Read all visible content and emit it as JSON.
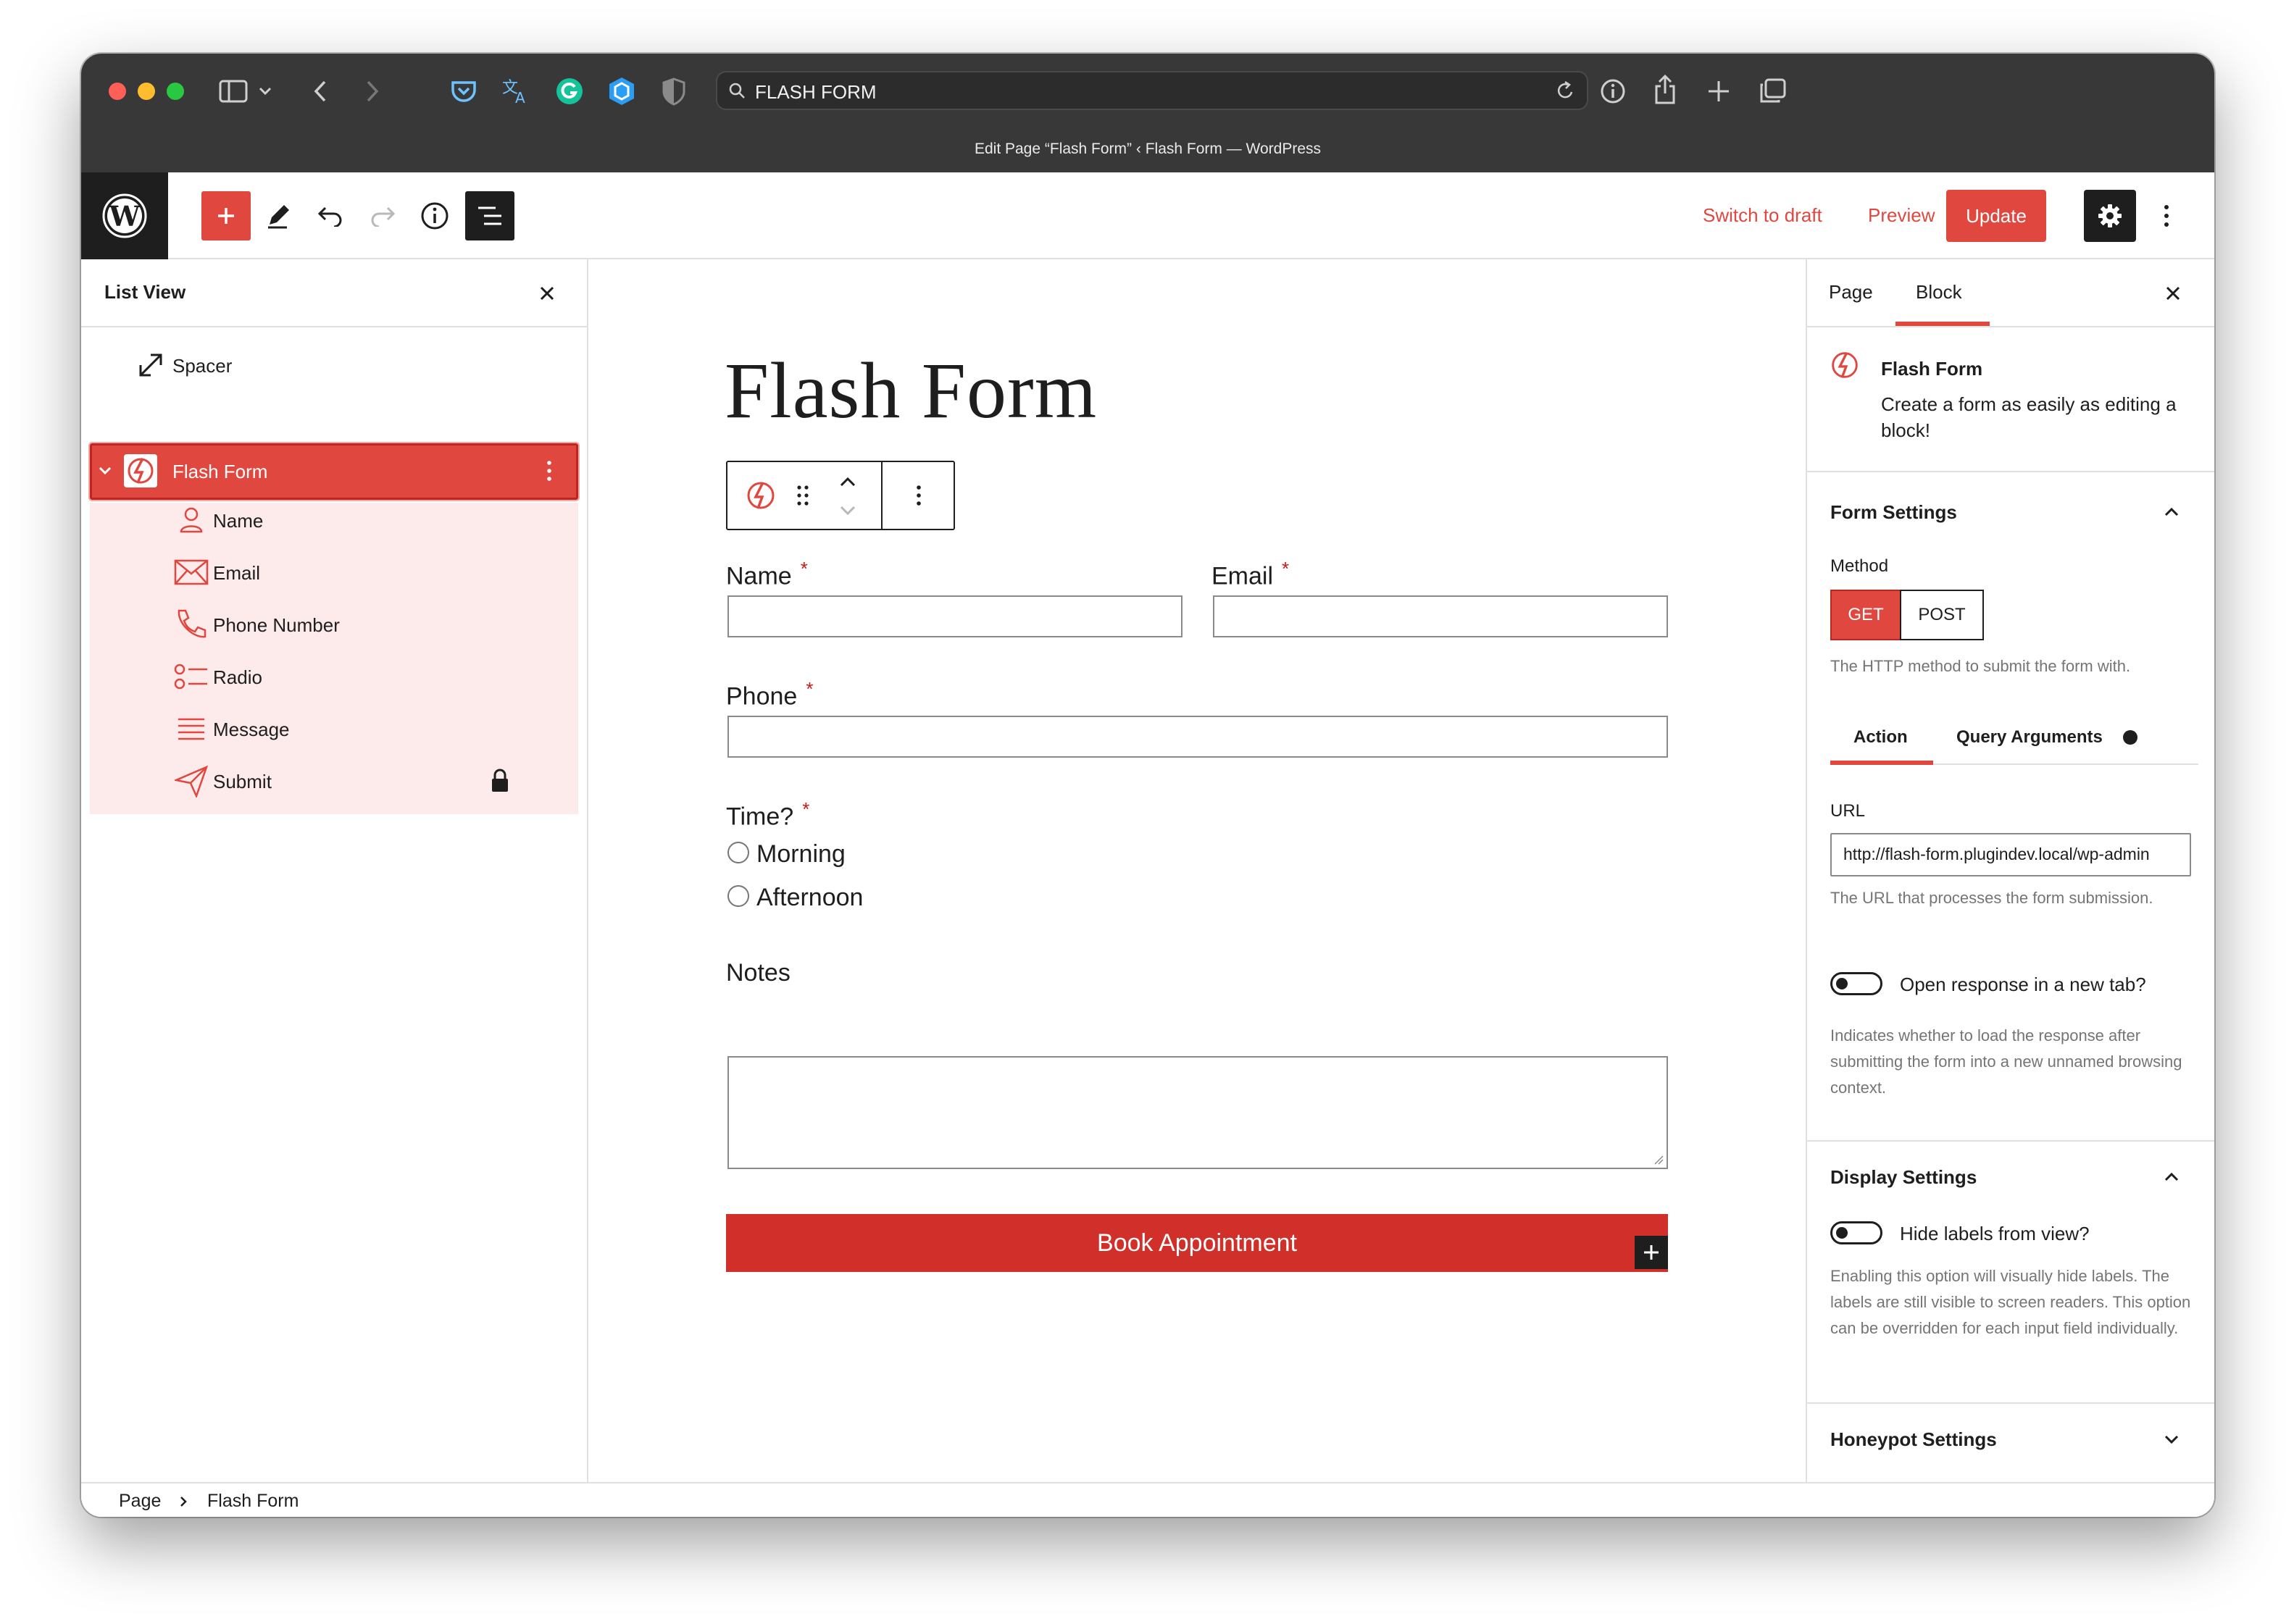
{
  "browser": {
    "url": "FLASH FORM",
    "window_title": "Edit Page “Flash Form” ‹ Flash Form — WordPress"
  },
  "toolbar": {
    "switch_to_draft": "Switch to draft",
    "preview": "Preview",
    "update": "Update"
  },
  "list_view": {
    "title": "List View",
    "items": [
      {
        "label": "Spacer",
        "icon": "spacer-icon"
      },
      {
        "label": "Flash Form",
        "icon": "flash-form-icon"
      },
      {
        "label": "Name",
        "icon": "person-icon"
      },
      {
        "label": "Email",
        "icon": "envelope-icon"
      },
      {
        "label": "Phone Number",
        "icon": "phone-icon"
      },
      {
        "label": "Radio",
        "icon": "radio-list-icon"
      },
      {
        "label": "Message",
        "icon": "lines-icon"
      },
      {
        "label": "Submit",
        "icon": "send-icon"
      }
    ]
  },
  "editor": {
    "title": "Flash Form",
    "required_mark": "*",
    "fields": {
      "name_label": "Name",
      "email_label": "Email",
      "phone_label": "Phone",
      "time_label": "Time?",
      "time_options": [
        "Morning",
        "Afternoon"
      ],
      "notes_label": "Notes"
    },
    "submit_label": "Book Appointment"
  },
  "sidebar": {
    "tabs": [
      "Page",
      "Block"
    ],
    "active_tab": "Block",
    "block_name": "Flash Form",
    "block_description": "Create a form as easily as editing a block!",
    "form_settings": {
      "title": "Form Settings",
      "method_label": "Method",
      "methods": [
        "GET",
        "POST"
      ],
      "method_selected": "GET",
      "method_help": "The HTTP method to submit the form with.",
      "subtabs": [
        "Action",
        "Query Arguments"
      ],
      "active_subtab": "Action",
      "url_label": "URL",
      "url_value": "http://flash-form.plugindev.local/wp-admin",
      "url_help": "The URL that processes the form submission.",
      "new_tab_label": "Open response in a new tab?",
      "new_tab_help": "Indicates whether to load the response after submitting the form into a new unnamed browsing context."
    },
    "display_settings": {
      "title": "Display Settings",
      "hide_labels_label": "Hide labels from view?",
      "hide_labels_help": "Enabling this option will visually hide labels. The labels are still visible to screen readers. This option can be overridden for each input field individually."
    },
    "honeypot_settings": {
      "title": "Honeypot Settings"
    }
  },
  "breadcrumb": [
    "Page",
    "Flash Form"
  ],
  "colors": {
    "accent": "#e0473f",
    "submit": "#d12f2a",
    "dark": "#1e1e1e",
    "chrome": "#383838"
  }
}
